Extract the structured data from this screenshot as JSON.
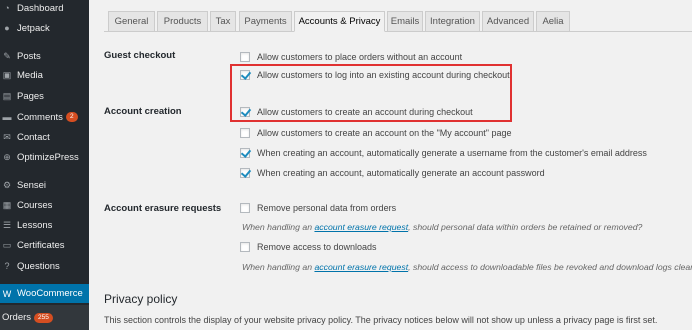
{
  "sidebar": {
    "items": [
      {
        "label": "Dashboard",
        "icon": "dashboard-icon"
      },
      {
        "label": "Jetpack",
        "icon": "jetpack-icon"
      },
      {
        "label": "Posts",
        "icon": "pin-icon"
      },
      {
        "label": "Media",
        "icon": "media-icon"
      },
      {
        "label": "Pages",
        "icon": "pages-icon"
      },
      {
        "label": "Comments",
        "icon": "comments-icon",
        "badge": "2"
      },
      {
        "label": "Contact",
        "icon": "mail-icon"
      },
      {
        "label": "OptimizePress",
        "icon": "optimizepress-icon"
      },
      {
        "label": "Sensei",
        "icon": "sensei-icon"
      },
      {
        "label": "Courses",
        "icon": "courses-icon"
      },
      {
        "label": "Lessons",
        "icon": "lessons-icon"
      },
      {
        "label": "Certificates",
        "icon": "certificates-icon"
      },
      {
        "label": "Questions",
        "icon": "questions-icon"
      },
      {
        "label": "WooCommerce",
        "icon": "woocommerce-icon"
      },
      {
        "label": "Orders",
        "badge": "255"
      }
    ]
  },
  "tabs": [
    "General",
    "Products",
    "Tax",
    "Payments",
    "Accounts & Privacy",
    "Emails",
    "Integration",
    "Advanced",
    "Aelia"
  ],
  "active_tab": "Accounts & Privacy",
  "settings": {
    "guest_checkout": {
      "label": "Guest checkout",
      "options": [
        {
          "text": "Allow customers to place orders without an account",
          "checked": false
        },
        {
          "text": "Allow customers to log into an existing account during checkout",
          "checked": true
        }
      ]
    },
    "account_creation": {
      "label": "Account creation",
      "options": [
        {
          "text": "Allow customers to create an account during checkout",
          "checked": true
        },
        {
          "text": "Allow customers to create an account on the \"My account\" page",
          "checked": false
        },
        {
          "text": "When creating an account, automatically generate a username from the customer's email address",
          "checked": true
        },
        {
          "text": "When creating an account, automatically generate an account password",
          "checked": true
        }
      ]
    },
    "erasure": {
      "label": "Account erasure requests",
      "remove_personal": {
        "text": "Remove personal data from orders",
        "checked": false
      },
      "desc1_pre": "When handling an ",
      "desc1_link": "account erasure request",
      "desc1_post": ", should personal data within orders be retained or removed?",
      "remove_downloads": {
        "text": "Remove access to downloads",
        "checked": false
      },
      "desc2_pre": "When handling an ",
      "desc2_link": "account erasure request",
      "desc2_post": ", should access to downloadable files be revoked and download logs cleared?"
    }
  },
  "privacy": {
    "title": "Privacy policy",
    "text": "This section controls the display of your website privacy policy. The privacy notices below will not show up unless a privacy page is first set."
  },
  "colors": {
    "sidebar_bg": "#23282d",
    "active_menu": "#0073aa",
    "badge": "#d54e21",
    "highlight": "#e03131",
    "link": "#0073aa"
  }
}
